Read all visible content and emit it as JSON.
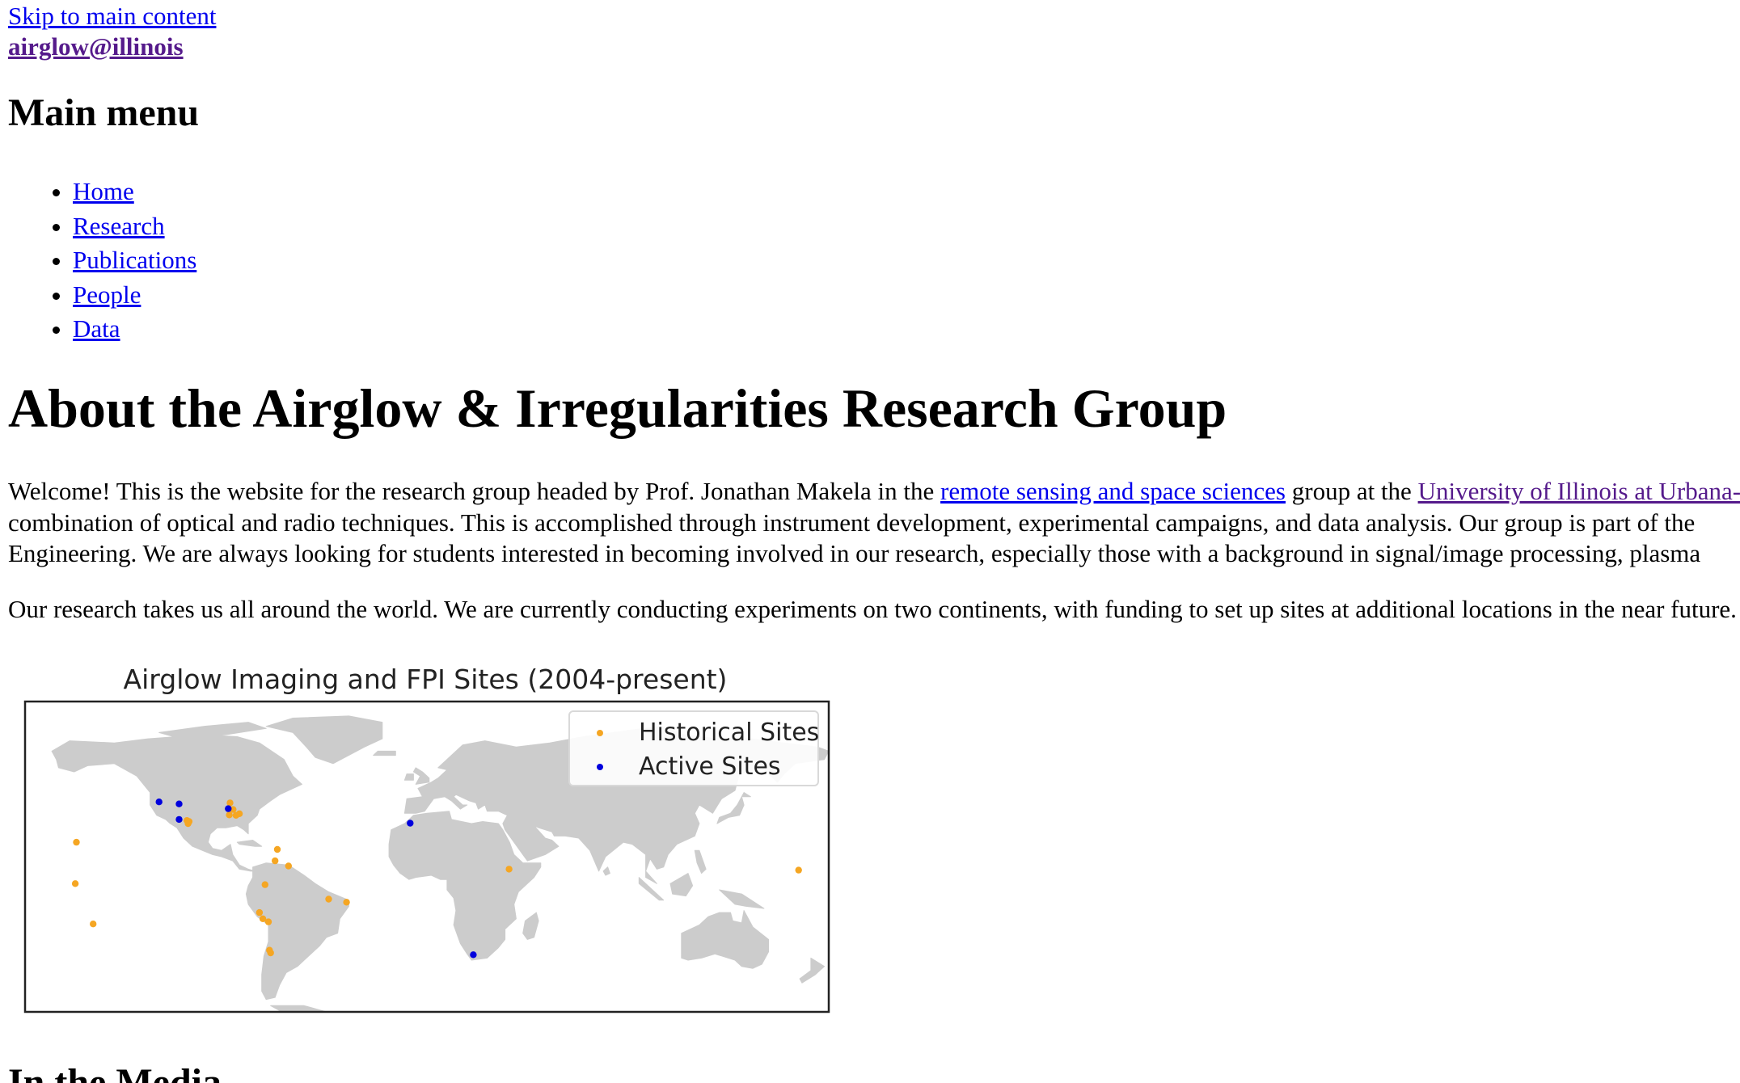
{
  "skip_link": "Skip to main content",
  "site_name": "airglow@illinois",
  "main_menu": {
    "heading": "Main menu",
    "items": [
      {
        "label": "Home"
      },
      {
        "label": "Research"
      },
      {
        "label": "Publications"
      },
      {
        "label": "People"
      },
      {
        "label": "Data"
      }
    ]
  },
  "page_title": "About the Airglow & Irregularities Research Group",
  "intro": {
    "line1_a": "Welcome!  This is the website for the research group headed by Prof. Jonathan Makela in the ",
    "link_rsss": "remote sensing and space sciences",
    "line1_b": " group at the ",
    "link_uiuc": "University of Illinois at Urbana-Champaign",
    "line2": "combination of optical and radio techniques. This is accomplished through instrument development, experimental campaigns, and data analysis. Our group is part of the",
    "line3": "Engineering. We are always looking for students interested in becoming involved in our research, especially those with a background in signal/image processing, plasma"
  },
  "research_text": "Our research takes us all around the world. We are currently conducting experiments on two continents, with funding to set up sites at additional locations in the near future.",
  "map": {
    "title": "Airglow Imaging and FPI Sites (2004-present)",
    "legend": [
      {
        "label": "Historical Sites",
        "color": "#f5a623"
      },
      {
        "label": "Active Sites",
        "color": "#0000dd"
      }
    ],
    "land_color": "#cccccc",
    "historical_sites": [
      [
        -157.0,
        22.0
      ],
      [
        -157.5,
        2.0
      ],
      [
        -149.5,
        -17.5
      ],
      [
        -107.5,
        32.5
      ],
      [
        -106.5,
        32.0
      ],
      [
        -107.0,
        31.0
      ],
      [
        -88.2,
        41.0
      ],
      [
        -86.8,
        37.8
      ],
      [
        -88.5,
        35.2
      ],
      [
        -85.5,
        35.0
      ],
      [
        -84.0,
        35.8
      ],
      [
        -67.0,
        18.5
      ],
      [
        -68.0,
        13.0
      ],
      [
        -62.0,
        10.5
      ],
      [
        -72.5,
        1.5
      ],
      [
        -44.0,
        -5.5
      ],
      [
        -36.0,
        -7.0
      ],
      [
        -75.0,
        -12.0
      ],
      [
        -73.5,
        -15.0
      ],
      [
        -71.0,
        -16.5
      ],
      [
        -70.5,
        -30.2
      ],
      [
        -70.0,
        -31.5
      ],
      [
        36.8,
        9.0
      ],
      [
        166.5,
        8.5
      ]
    ],
    "active_sites": [
      [
        -120.0,
        41.5
      ],
      [
        -111.0,
        40.5
      ],
      [
        -111.0,
        33.0
      ],
      [
        -89.0,
        38.2
      ],
      [
        -7.5,
        31.2
      ],
      [
        20.8,
        -32.4
      ]
    ]
  },
  "media_heading": "In the Media"
}
